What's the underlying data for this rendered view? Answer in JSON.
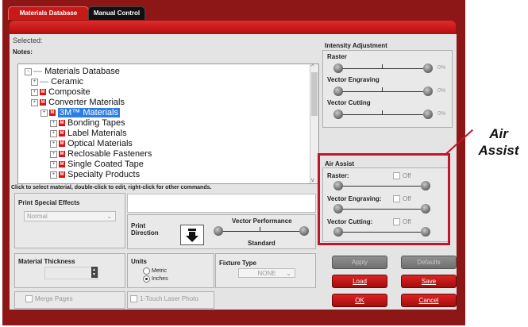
{
  "tabs": [
    {
      "label": "Materials Database"
    },
    {
      "label": "Manual Control"
    }
  ],
  "selected_label": "Selected:",
  "notes_label": "Notes:",
  "tree": [
    {
      "label": "Materials Database",
      "indent": 0,
      "type": "root"
    },
    {
      "label": "Ceramic",
      "indent": 1,
      "type": "plain"
    },
    {
      "label": "Composite",
      "indent": 1,
      "type": "material"
    },
    {
      "label": "Converter Materials",
      "indent": 1,
      "type": "material"
    },
    {
      "label": "3M™ Materials",
      "indent": 2,
      "type": "material",
      "selected": true
    },
    {
      "label": "Bonding Tapes",
      "indent": 3,
      "type": "material"
    },
    {
      "label": "Label Materials",
      "indent": 3,
      "type": "material"
    },
    {
      "label": "Optical Materials",
      "indent": 3,
      "type": "material"
    },
    {
      "label": "Reclosable Fasteners",
      "indent": 3,
      "type": "material"
    },
    {
      "label": "Single Coated Tape",
      "indent": 3,
      "type": "material"
    },
    {
      "label": "Specialty Products",
      "indent": 3,
      "type": "material"
    }
  ],
  "hint_text": "Click to select material, double-click to edit, right-click for other commands.",
  "intensity": {
    "title": "Intensity Adjustment",
    "rows": [
      {
        "label": "Raster",
        "value": "0%",
        "level": 0.5
      },
      {
        "label": "Vector Engraving",
        "value": "0%",
        "level": 0.5
      },
      {
        "label": "Vector Cutting",
        "value": "0%",
        "level": 0.5
      }
    ]
  },
  "air_assist": {
    "title": "Air Assist",
    "rows": [
      {
        "label": "Raster:",
        "state": "Off"
      },
      {
        "label": "Vector Engraving:",
        "state": "Off"
      },
      {
        "label": "Vector Cutting:",
        "state": "Off"
      }
    ]
  },
  "callout_label": "Air Assist",
  "print_effects": {
    "title": "Print Special Effects",
    "value": "Normal"
  },
  "print_direction": {
    "label": "Print Direction",
    "icon": "arrow-down-icon"
  },
  "vector_performance": {
    "title": "Vector Performance",
    "value": "Standard",
    "level": 0.5
  },
  "material_thickness": {
    "title": "Material Thickness"
  },
  "units": {
    "title": "Units",
    "options": [
      "Metric",
      "Inches"
    ],
    "selected": "Inches"
  },
  "fixture_type": {
    "title": "Fixture Type",
    "value": "NONE"
  },
  "merge_pages": {
    "label": "Merge Pages"
  },
  "one_touch": {
    "label": "1-Touch Laser Photo"
  },
  "buttons": {
    "apply": "Apply",
    "defaults": "Defaults",
    "load": "Load",
    "save": "Save",
    "ok": "OK",
    "cancel": "Cancel"
  }
}
